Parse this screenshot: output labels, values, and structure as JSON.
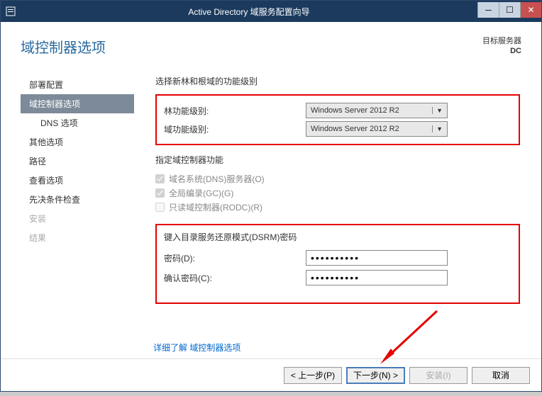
{
  "titlebar": {
    "title": "Active Directory 域服务配置向导"
  },
  "header": {
    "title": "域控制器选项",
    "target_label": "目标服务器",
    "target_value": "DC"
  },
  "nav": {
    "items": [
      {
        "label": "部署配置",
        "active": false
      },
      {
        "label": "域控制器选项",
        "active": true
      },
      {
        "label": "DNS 选项",
        "sub": true
      },
      {
        "label": "其他选项"
      },
      {
        "label": "路径"
      },
      {
        "label": "查看选项"
      },
      {
        "label": "先决条件检查"
      },
      {
        "label": "安装",
        "disabled": true
      },
      {
        "label": "结果",
        "disabled": true
      }
    ]
  },
  "main": {
    "section1_title": "选择新林和根域的功能级别",
    "forest_label": "林功能级别:",
    "forest_value": "Windows Server 2012 R2",
    "domain_label": "域功能级别:",
    "domain_value": "Windows Server 2012 R2",
    "section2_title": "指定域控制器功能",
    "cb_dns": "域名系统(DNS)服务器(O)",
    "cb_gc": "全局编录(GC)(G)",
    "cb_rodc": "只读域控制器(RODC)(R)",
    "section3_title": "键入目录服务还原模式(DSRM)密码",
    "pwd_label": "密码(D):",
    "pwd_value": "●●●●●●●●●●",
    "pwd2_label": "确认密码(C):",
    "pwd2_value": "●●●●●●●●●●",
    "link_more": "详细了解 域控制器选项"
  },
  "footer": {
    "prev": "< 上一步(P)",
    "next": "下一步(N) >",
    "install": "安装(I)",
    "cancel": "取消"
  }
}
